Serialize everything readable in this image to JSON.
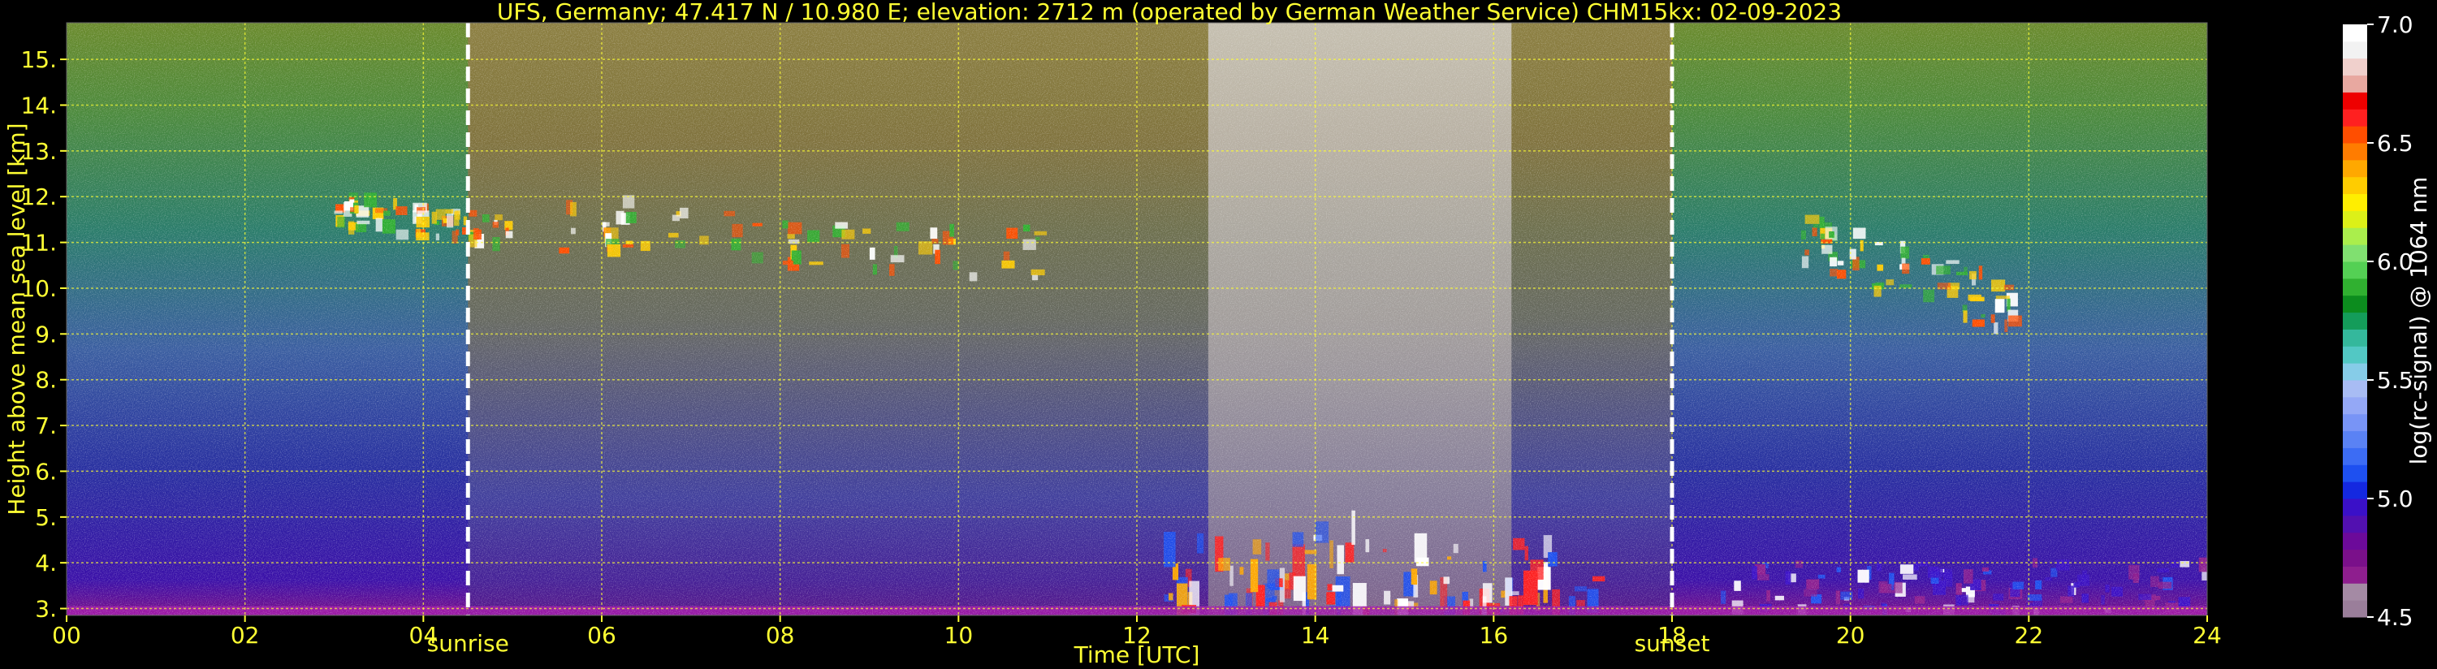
{
  "chart_data": {
    "type": "heatmap",
    "title": "UFS, Germany; 47.417 N / 10.980 E; elevation: 2712 m  (operated by German Weather Service)    CHM15kx: 02-09-2023",
    "xlabel": "Time [UTC]",
    "ylabel": "Height above mean sea level [km]",
    "xlim": [
      0,
      24
    ],
    "ylim": [
      2.85,
      15.8
    ],
    "x_ticks": [
      0,
      2,
      4,
      6,
      8,
      10,
      12,
      14,
      16,
      18,
      20,
      22,
      24
    ],
    "x_tick_labels": [
      "00",
      "02",
      "04",
      "06",
      "08",
      "10",
      "12",
      "14",
      "16",
      "18",
      "20",
      "22",
      "24"
    ],
    "y_ticks": [
      3,
      4,
      5,
      6,
      7,
      8,
      9,
      10,
      11,
      12,
      13,
      14,
      15
    ],
    "y_tick_labels": [
      "3.",
      "4.",
      "5.",
      "6.",
      "7.",
      "8.",
      "9.",
      "10.",
      "11.",
      "12.",
      "13.",
      "14.",
      "15."
    ],
    "grid": true,
    "annotations": [
      {
        "x": 4.5,
        "label": "sunrise",
        "style": "dashed-white-line"
      },
      {
        "x": 18.0,
        "label": "sunset",
        "style": "dashed-white-line"
      }
    ],
    "colorbar": {
      "label": "log(rc-signal) @ 1064 nm",
      "range": [
        4.5,
        7.0
      ],
      "ticks": [
        4.5,
        5.0,
        5.5,
        6.0,
        6.5,
        7.0
      ],
      "tick_labels": [
        "4.5",
        "5.0",
        "5.5",
        "6.0",
        "6.5",
        "7.0"
      ],
      "colors": [
        "#9a7e9a",
        "#a48aa4",
        "#8e1e8e",
        "#7a108a",
        "#6c0a9a",
        "#5210b0",
        "#3a10c8",
        "#1428e0",
        "#1e50f0",
        "#3c6cf4",
        "#5a82f4",
        "#7894f6",
        "#94a8f6",
        "#a8bcf4",
        "#86cce8",
        "#52c8c4",
        "#34b89c",
        "#149c5a",
        "#0c8c1e",
        "#30b030",
        "#54d054",
        "#80e070",
        "#aaee4c",
        "#dcf018",
        "#ffee00",
        "#ffcc00",
        "#ffa800",
        "#ff7c00",
        "#ff4e00",
        "#ff2020",
        "#ee0000",
        "#e8a8a0",
        "#f0d0cc",
        "#f2f2f2",
        "#ffffff"
      ]
    },
    "features": [
      {
        "type": "cirrus",
        "x_range": [
          3.0,
          5.0
        ],
        "y_range": [
          10.6,
          12.0
        ]
      },
      {
        "type": "cirrus",
        "x_range": [
          5.5,
          11.0
        ],
        "y_range": [
          9.6,
          12.0
        ]
      },
      {
        "type": "cirrus",
        "x_range": [
          19.4,
          21.8
        ],
        "y_range": [
          9.2,
          11.6
        ]
      },
      {
        "type": "convective_boundary_layer",
        "x_range": [
          12.3,
          17.2
        ],
        "y_range": [
          2.9,
          5.2
        ]
      },
      {
        "type": "boundary_layer",
        "x_range": [
          18.5,
          24.0
        ],
        "y_range": [
          2.9,
          4.0
        ]
      },
      {
        "type": "solar_background_noise",
        "x_range": [
          4.5,
          18.0
        ],
        "y_range": [
          2.9,
          15.8
        ]
      }
    ]
  }
}
